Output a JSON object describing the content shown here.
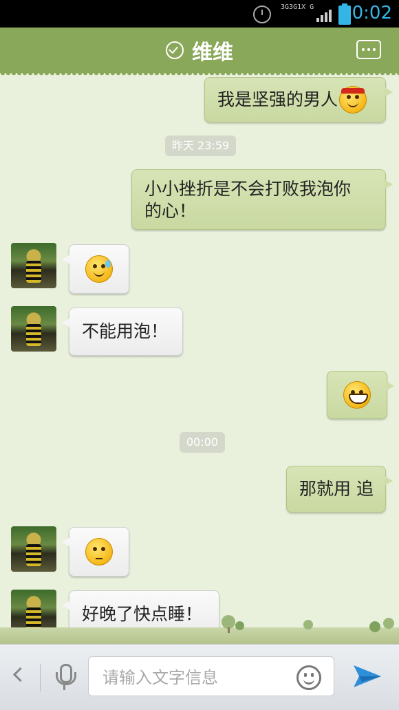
{
  "status_bar": {
    "network_labels": [
      "3G",
      "3G",
      "1X",
      "G"
    ],
    "time": "0:02"
  },
  "header": {
    "title": "维维",
    "verified_icon": "check-circle-icon",
    "more_icon": "chat-more-icon",
    "color": "#8aa85a"
  },
  "messages": [
    {
      "direction": "out",
      "text": "我是坚强的男人",
      "emoji": "angry-face"
    },
    {
      "type": "timestamp",
      "text": "昨天 23:59"
    },
    {
      "direction": "out",
      "text_line1": "小小挫折是不会打败我泡你",
      "text_line2": "的心！"
    },
    {
      "direction": "in",
      "emoji": "sweat-face"
    },
    {
      "direction": "in",
      "text": "不能用泡！"
    },
    {
      "direction": "out",
      "emoji": "grin-face"
    },
    {
      "type": "timestamp",
      "text": "00:00"
    },
    {
      "direction": "out",
      "text": "那就用 追"
    },
    {
      "direction": "in",
      "emoji": "confused-face"
    },
    {
      "direction": "in",
      "text": "好晚了快点睡！"
    }
  ],
  "input_bar": {
    "placeholder": "请输入文字信息",
    "back_icon": "chevron-left-icon",
    "voice_icon": "microphone-icon",
    "emoji_icon": "smiley-icon",
    "send_icon": "send-plane-icon"
  },
  "colors": {
    "outgoing_bubble": "#cfdeab",
    "incoming_bubble": "#f5f5f5",
    "background": "#e9f0dc",
    "accent": "#33b5e5"
  }
}
